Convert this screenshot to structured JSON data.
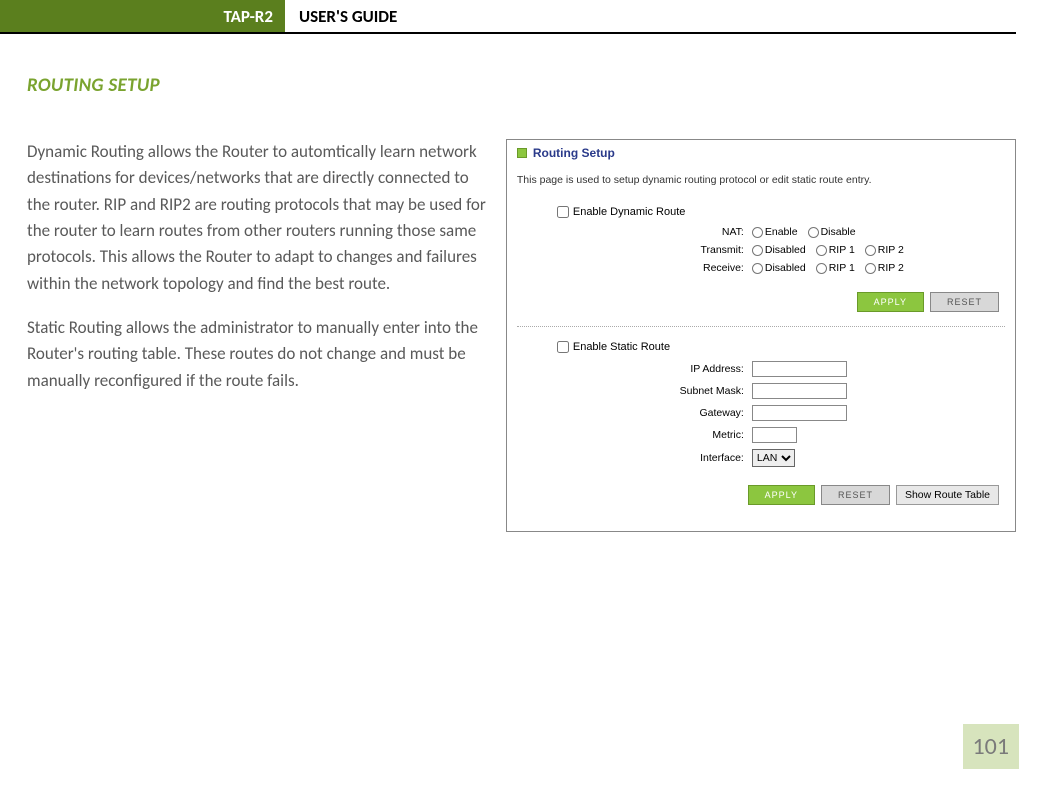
{
  "header": {
    "product": "TAP-R2",
    "title": "USER'S GUIDE"
  },
  "section_title": "ROUTING SETUP",
  "body": {
    "p1": "Dynamic Routing allows the Router to automtically learn network destinations for devices/networks that are directly connected to the router. RIP and RIP2 are routing protocols that may be used for the router to learn routes from other routers running those same protocols. This allows the Router to adapt to changes and failures within the network topology and find the best route.",
    "p2": "Static Routing allows the administrator to manually enter into the Router's routing table. These routes do not change and must be manually reconfigured if the route fails."
  },
  "panel": {
    "title": "Routing Setup",
    "desc": "This page is used to setup dynamic routing protocol or edit static route entry.",
    "dynamic": {
      "enable_label": "Enable Dynamic Route",
      "nat": {
        "label": "NAT:",
        "opt1": "Enable",
        "opt2": "Disable"
      },
      "transmit": {
        "label": "Transmit:",
        "opt1": "Disabled",
        "opt2": "RIP 1",
        "opt3": "RIP 2"
      },
      "receive": {
        "label": "Receive:",
        "opt1": "Disabled",
        "opt2": "RIP 1",
        "opt3": "RIP 2"
      }
    },
    "static": {
      "enable_label": "Enable Static Route",
      "ip_label": "IP Address:",
      "subnet_label": "Subnet Mask:",
      "gateway_label": "Gateway:",
      "metric_label": "Metric:",
      "interface_label": "Interface:",
      "interface_value": "LAN"
    },
    "buttons": {
      "apply": "APPLY",
      "reset": "RESET",
      "show_table": "Show Route Table"
    }
  },
  "page_number": "101"
}
